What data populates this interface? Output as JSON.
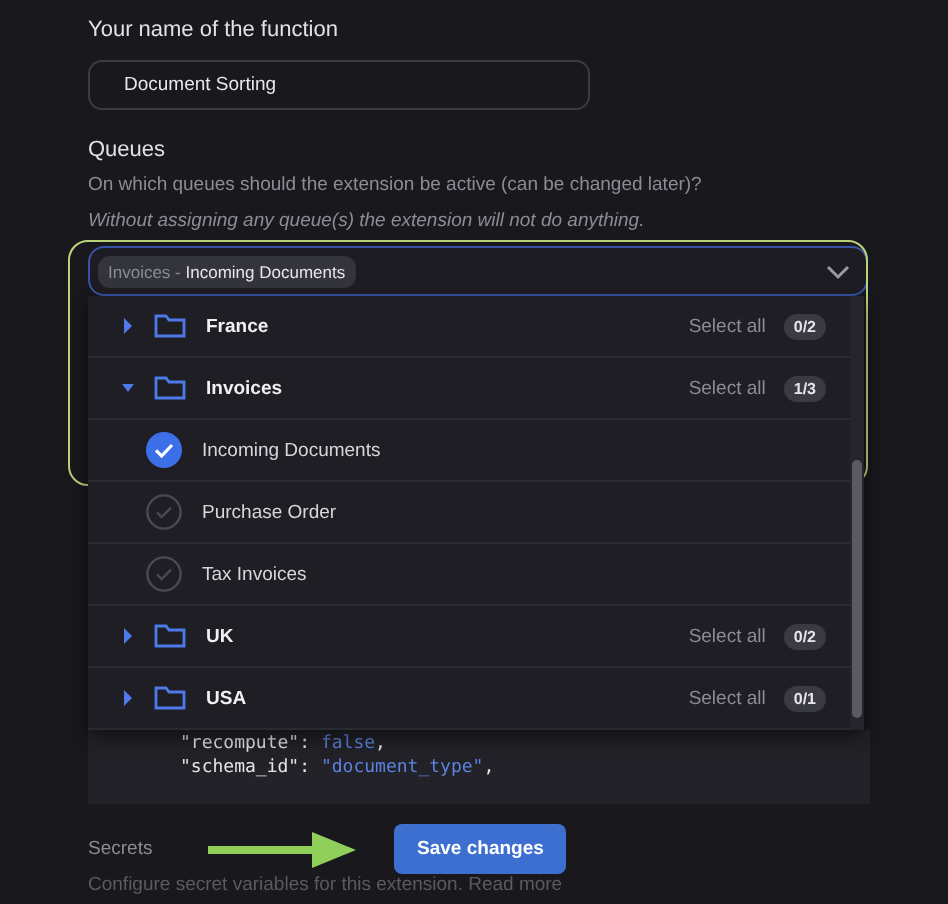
{
  "name_field": {
    "label": "Your name of the function",
    "value": "Document Sorting"
  },
  "queues": {
    "title": "Queues",
    "description": "On which queues should the extension be active (can be changed later)?",
    "note": "Without assigning any queue(s) the extension will not do anything.",
    "select": {
      "chips": [
        {
          "parent": "Invoices",
          "separator": "-",
          "label": "Incoming Documents"
        }
      ],
      "highlighted": true
    },
    "tree": [
      {
        "label": "France",
        "expanded": false,
        "select_all": "Select all",
        "count": "0/2"
      },
      {
        "label": "Invoices",
        "expanded": true,
        "select_all": "Select all",
        "count": "1/3",
        "children": [
          {
            "label": "Incoming Documents",
            "checked": true
          },
          {
            "label": "Purchase Order",
            "checked": false
          },
          {
            "label": "Tax Invoices",
            "checked": false
          }
        ]
      },
      {
        "label": "UK",
        "expanded": false,
        "select_all": "Select all",
        "count": "0/2"
      },
      {
        "label": "USA",
        "expanded": false,
        "select_all": "Select all",
        "count": "0/1"
      }
    ]
  },
  "code": [
    {
      "key": "\"recompute\"",
      "sep": ": ",
      "value": "false",
      "end": ","
    },
    {
      "key": "\"schema_id\"",
      "sep": ": ",
      "value": "\"document_type\"",
      "end": ","
    }
  ],
  "secrets": {
    "title": "Secrets",
    "description": "Configure secret variables for this extension. Read more"
  },
  "save_button": {
    "label": "Save changes"
  }
}
